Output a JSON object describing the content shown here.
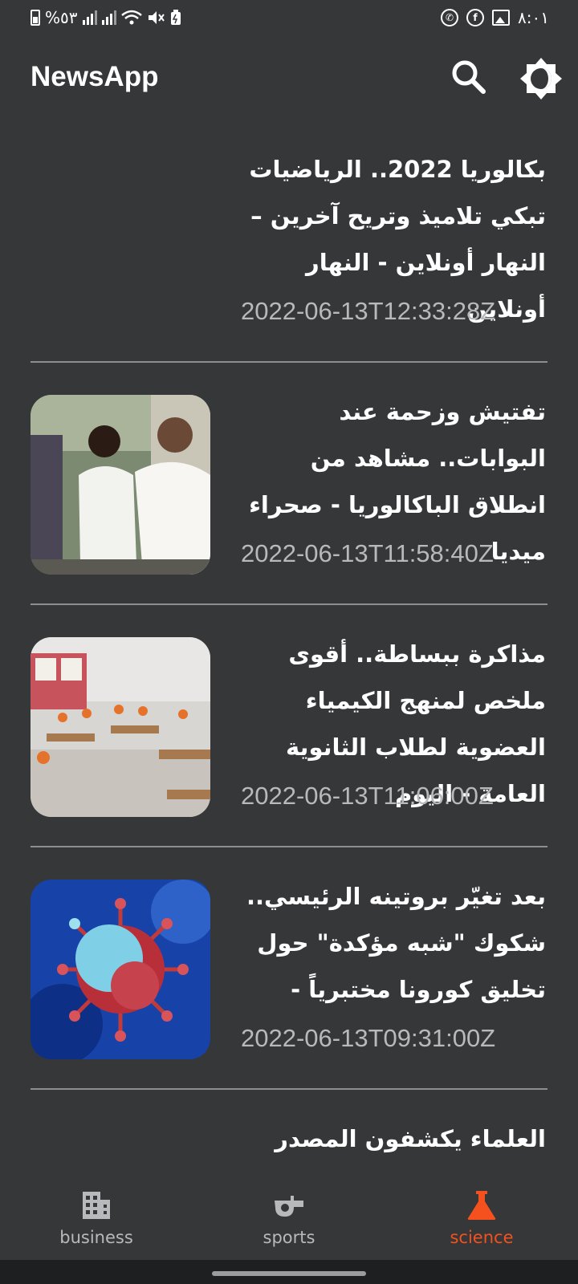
{
  "status_bar": {
    "battery_text": "%٥٣",
    "time": "٨:٠١"
  },
  "app_bar": {
    "title": "NewsApp"
  },
  "articles": [
    {
      "title": "بكالوريا 2022.. الرياضيات تبكي تلاميذ وتريح آخرين – النهار أونلاين - النهار أونلاين",
      "date": "2022-06-13T12:33:28Z",
      "image": "none"
    },
    {
      "title": "تفتيش وزحمة عند البوابات.. مشاهد من انطلاق الباكالوريا - صحراء ميديا",
      "date": "2022-06-13T11:58:40Z",
      "image": "students-at-gate-photo"
    },
    {
      "title": "مذاكرة ببساطة.. أقوى ملخص لمنهج الكيمياء العضوية لطلاب الثانوية العامة - اليوم",
      "date": "2022-06-13T11:06:00Z",
      "image": "exam-classroom-photo"
    },
    {
      "title": "بعد تغيّر بروتينه الرئيسي.. شكوك \"شبه مؤكدة\" حول تخليق كورونا مختبرياً -",
      "date": "2022-06-13T09:31:00Z",
      "image": "coronavirus-illustration"
    },
    {
      "title": "العلماء يكشفون المصدر",
      "date": "",
      "image": "none"
    }
  ],
  "bottom_nav": {
    "items": [
      {
        "label": "business",
        "icon": "building-icon"
      },
      {
        "label": "sports",
        "icon": "whistle-icon"
      },
      {
        "label": "science",
        "icon": "flask-icon"
      }
    ],
    "selected": "science"
  },
  "colors": {
    "background": "#353739",
    "accent": "#f4511e",
    "inactive": "#b7b9bc",
    "divider": "#8c8e90"
  }
}
